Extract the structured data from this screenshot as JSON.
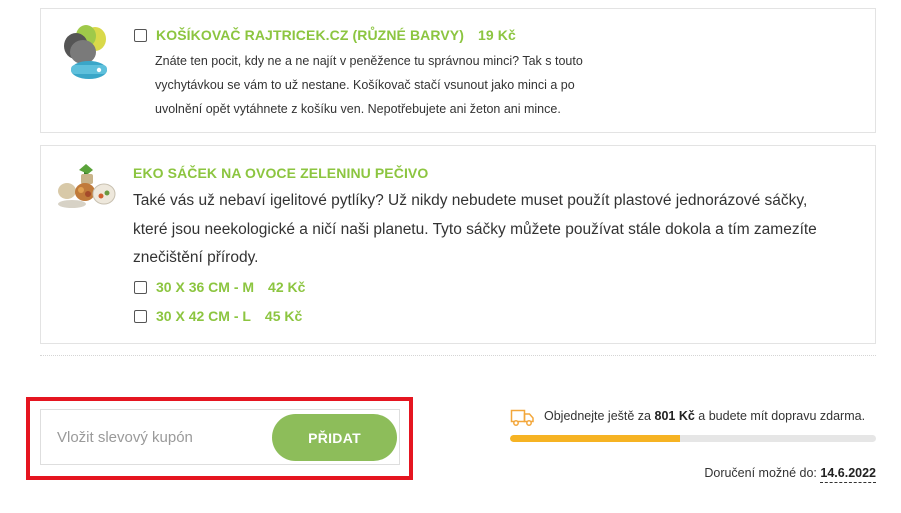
{
  "products": [
    {
      "title": "KOŠÍKOVAČ RAJTRICEK.CZ (RŮZNÉ BARVY)",
      "price": "19 Kč",
      "description_lines": [
        "Znáte ten pocit, kdy ne a ne najít v peněžence tu správnou minci? Tak s touto",
        "vychytávkou se vám to už nestane. Košíkovač stačí vsunout jako minci a po",
        "uvolnění opět vytáhnete z košíku ven. Nepotřebujete ani žeton ani mince."
      ],
      "icon": "basket-coin-keychain-image"
    },
    {
      "title": "EKO SÁČEK NA OVOCE ZELENINU PEČIVO",
      "description_lines": [
        "Také vás už nebaví igelitové pytlíky? Už nikdy nebudete muset použít plastové jednorázové sáčky,",
        "které jsou neekologické a ničí naši planetu. Tyto sáčky můžete používat stále dokola a tím zamezíte",
        "znečištění přírody."
      ],
      "variants": [
        {
          "label": "30 X 36 CM - M",
          "price": "42 Kč"
        },
        {
          "label": "30 X 42 CM - L",
          "price": "45 Kč"
        }
      ],
      "icon": "eco-bag-produce-image"
    }
  ],
  "coupon": {
    "placeholder": "Vložit slevový kupón",
    "button_label": "PŘIDAT"
  },
  "shipping": {
    "text_before": "Objednejte ještě za ",
    "amount": "801 Kč",
    "text_after": " a budete mít dopravu zdarma.",
    "progress_fraction": 0.465,
    "icon": "truck-icon"
  },
  "delivery": {
    "label": "Doručení možné do:",
    "date": "14.6.2022"
  },
  "colors": {
    "accent_green": "#8cc540",
    "button_green": "#8dbd5a",
    "progress_yellow": "#f6b323",
    "highlight_red": "#e51520"
  }
}
